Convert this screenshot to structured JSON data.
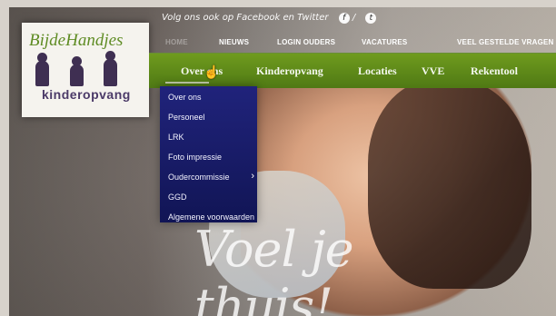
{
  "header": {
    "social_text": "Volg ons ook op Facebook en Twitter",
    "facebook_icon": "facebook-icon",
    "twitter_icon": "twitter-icon",
    "top_links": [
      "HOME",
      "NIEUWS",
      "LOGIN OUDERS",
      "VACATURES",
      "VEEL GESTELDE VRAGEN"
    ]
  },
  "logo": {
    "name": "BijdeHandjes",
    "subtitle": "kinderopvang"
  },
  "main_nav": [
    "Over ons",
    "Kinderopvang",
    "Locaties",
    "VVE",
    "Rekentool"
  ],
  "dropdown": {
    "items": [
      "Over ons",
      "Personeel",
      "LRK",
      "Foto impressie",
      "Oudercommissie",
      "GGD",
      "Algemene voorwaarden"
    ]
  },
  "hero": {
    "tagline": "Voel je thuis!"
  },
  "colors": {
    "green": "#5f8c24",
    "navy": "#20237b"
  }
}
